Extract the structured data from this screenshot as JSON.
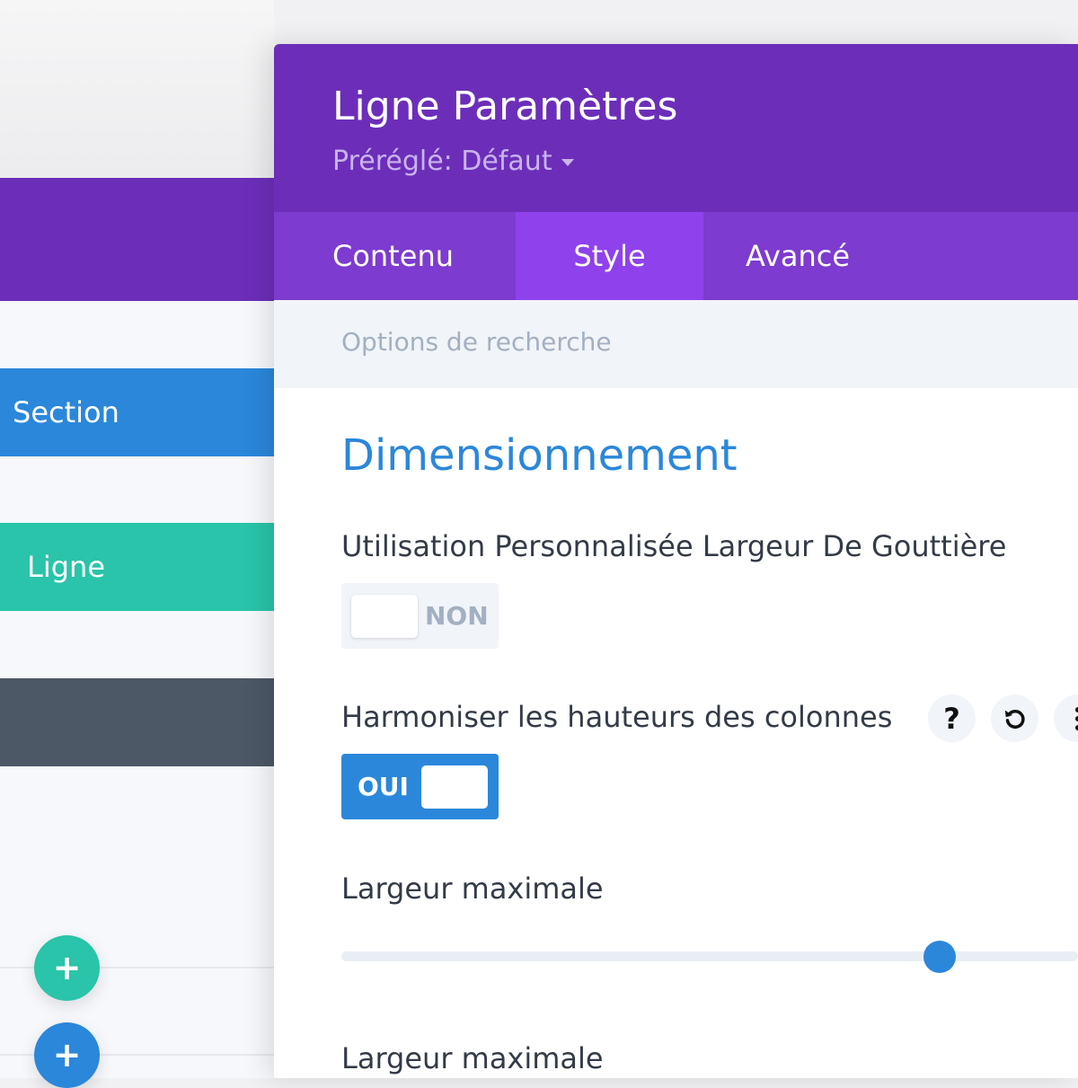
{
  "builder": {
    "section_label": "Section",
    "row_label": "Ligne",
    "add_buttons": [
      "+",
      "+"
    ]
  },
  "modal": {
    "title": "Ligne Paramètres",
    "preset": "Préréglé: Défaut",
    "tabs": [
      {
        "label": "Contenu",
        "active": false
      },
      {
        "label": "Style",
        "active": true
      },
      {
        "label": "Avancé",
        "active": false
      }
    ],
    "search_placeholder": "Options de recherche",
    "group_title": "Dimensionnement",
    "fields": {
      "gutter": {
        "label": "Utilisation Personnalisée Largeur De Gouttière",
        "toggle_text": "NON",
        "enabled": false
      },
      "equalize": {
        "label": "Harmoniser les hauteurs des colonnes",
        "toggle_text": "OUI",
        "enabled": true
      },
      "max_width": {
        "label": "Largeur maximale",
        "slider_value_fraction": 0.81
      },
      "max_width_2": {
        "label": "Largeur maximale"
      }
    },
    "icons": [
      "help-icon",
      "reset-icon",
      "more-options-icon"
    ]
  },
  "colors": {
    "purple_header": "#6c2eb9",
    "purple_tabs": "#7d3bcf",
    "purple_active_tab": "#8f42ec",
    "blue_accent": "#2b87da",
    "green_row": "#29c4a9",
    "dark_module": "#4c5866"
  }
}
